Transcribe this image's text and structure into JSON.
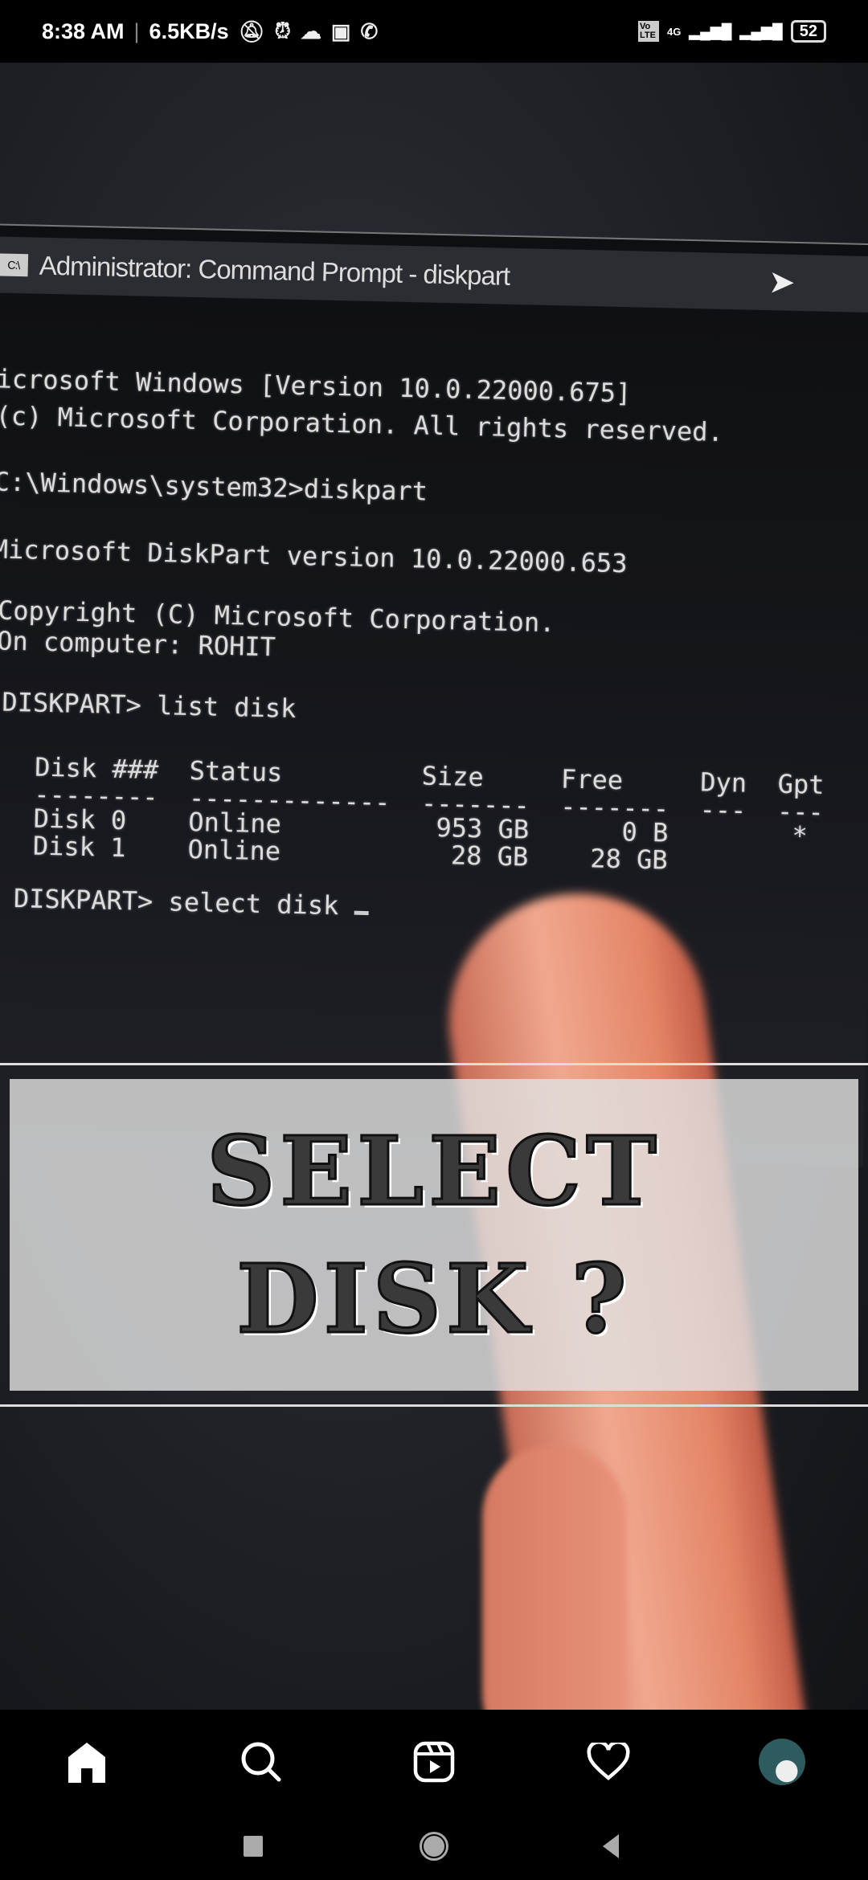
{
  "status_bar": {
    "time": "8:38 AM",
    "speed": "6.5KB/s",
    "network": "4G",
    "battery": "52",
    "volte": "Vo LTE"
  },
  "terminal": {
    "title": "Administrator: Command Prompt - diskpart",
    "lines": [
      "icrosoft Windows [Version 10.0.22000.675]",
      "(c) Microsoft Corporation. All rights reserved.",
      "C:\\Windows\\system32>diskpart",
      "Microsoft DiskPart version 10.0.22000.653",
      "Copyright (C) Microsoft Corporation.",
      "On computer: ROHIT",
      "DISKPART> list disk",
      "  Disk ###  Status         Size     Free     Dyn  Gpt",
      "  --------  -------------  -------  -------  ---  ---",
      "  Disk 0    Online          953 GB      0 B        *",
      "  Disk 1    Online           28 GB    28 GB",
      "DISKPART> select disk "
    ]
  },
  "caption": {
    "line1": "SELECT",
    "line2": "DISK ?"
  },
  "bottom_nav": [
    "home",
    "search",
    "reels",
    "activity",
    "profile"
  ],
  "colors": {
    "caption_bg": "#e1e1e1",
    "nav_bg": "#000000"
  }
}
